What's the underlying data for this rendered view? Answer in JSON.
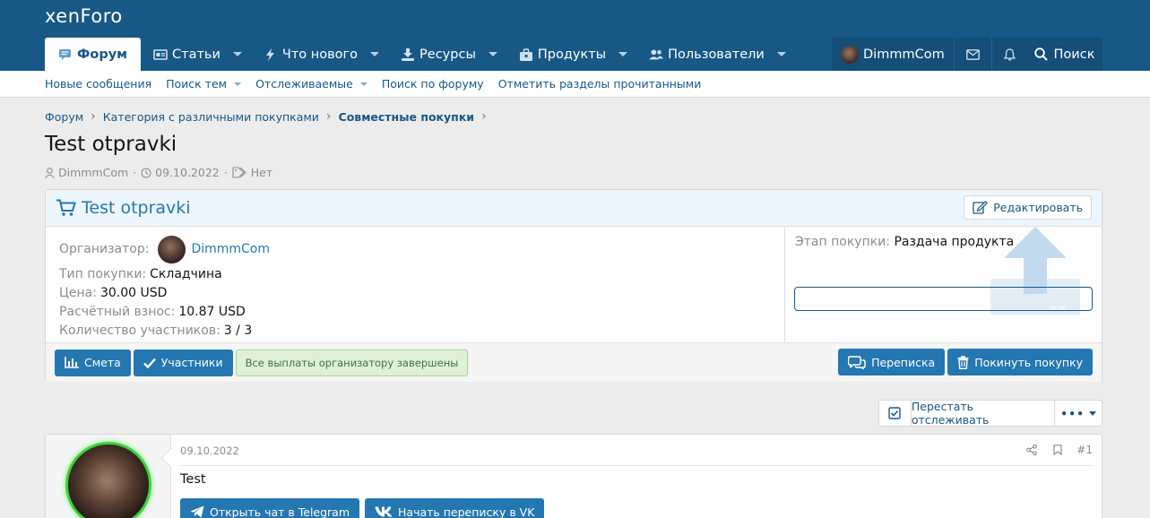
{
  "header": {
    "logo": "xenForo",
    "nav": [
      {
        "label": "Форум",
        "icon": "forum-icon",
        "active": true
      },
      {
        "label": "Статьи",
        "icon": "articles-icon"
      },
      {
        "label": "Что нового",
        "icon": "whats-new-icon"
      },
      {
        "label": "Ресурсы",
        "icon": "resources-icon"
      },
      {
        "label": "Продукты",
        "icon": "products-icon"
      },
      {
        "label": "Пользователи",
        "icon": "users-icon"
      }
    ],
    "username": "DimmmCom",
    "search_label": "Поиск"
  },
  "subnav": [
    "Новые сообщения",
    "Поиск тем",
    "Отслеживаемые",
    "Поиск по форуму",
    "Отметить разделы прочитанными"
  ],
  "breadcrumb": [
    "Форум",
    "Категория с различными покупками",
    "Совместные покупки"
  ],
  "thread": {
    "title": "Test otpravki",
    "author": "DimmmCom",
    "date": "09.10.2022",
    "tags": "Нет"
  },
  "purchase": {
    "title": "Test otpravki",
    "edit_label": "Редактировать",
    "organizer_label": "Организатор:",
    "organizer": "DimmmCom",
    "type_label": "Тип покупки:",
    "type_value": "Складчина",
    "price_label": "Цена:",
    "price_value": "30.00 USD",
    "fee_label": "Расчётный взнос:",
    "fee_value": "10.87 USD",
    "participants_label": "Количество участников:",
    "participants_value": "3 / 3",
    "stage_label": "Этап покупки:",
    "stage_value": "Раздача продукта",
    "estimate_label": "Смета",
    "members_label": "Участники",
    "payments_note": "Все выплаты организатору завершены",
    "chat_label": "Переписка",
    "leave_label": "Покинуть покупку"
  },
  "thread_actions": {
    "unwatch_label": "Перестать отслеживать",
    "more_label": "•••"
  },
  "post": {
    "date": "09.10.2022",
    "number": "#1",
    "body": "Test",
    "telegram_label": "Открыть чат в Telegram",
    "vk_label": "Начать переписку в VK"
  },
  "colors": {
    "header_bg": "#185886",
    "accent": "#2577b1",
    "success_bg": "#dff0d8",
    "online_ring": "#3bd13b"
  }
}
